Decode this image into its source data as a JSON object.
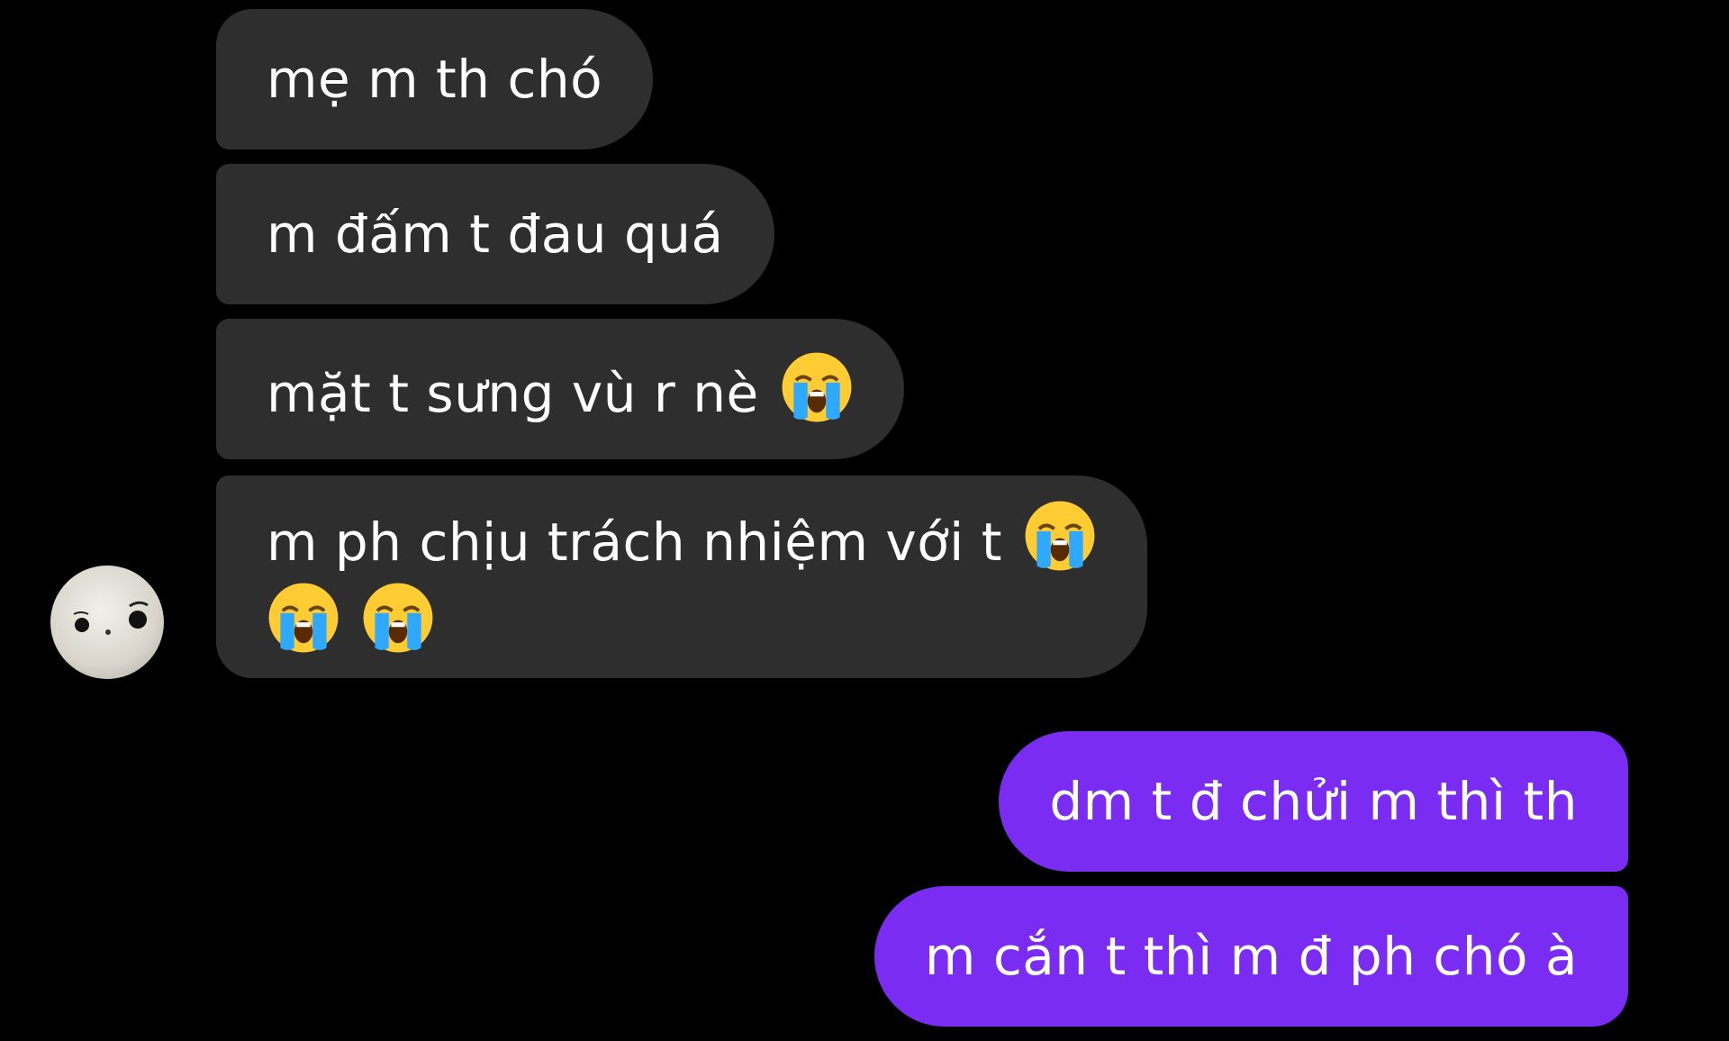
{
  "messages": {
    "incoming": [
      {
        "text": "mẹ m th chó"
      },
      {
        "text": "m đấm t đau quá"
      },
      {
        "text": "mặt t sưng vù r nè",
        "emoji": "loudly-crying-face"
      },
      {
        "text_line1": "m ph chịu trách nhiệm với t",
        "emoji": "loudly-crying-face"
      }
    ],
    "outgoing": [
      {
        "text": "dm t đ chửi m thì th"
      },
      {
        "text": "m cắn t thì m đ ph chó à"
      }
    ]
  },
  "colors": {
    "background": "#000000",
    "incoming_bubble": "#2e2e2e",
    "outgoing_bubble": "#7a2cf3",
    "text": "#ffffff"
  },
  "icons": {
    "avatar": "avatar",
    "emoji": "loudly-crying-face-icon"
  }
}
